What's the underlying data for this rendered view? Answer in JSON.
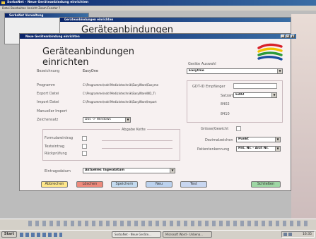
{
  "outer_window": {
    "title": "SorbaNet - Neue Geräteanbindung einrichten"
  },
  "menu": {
    "text": "Datei  Bearbeiten  Ansicht  Zoom  Fenster  ?"
  },
  "mdi_window": {
    "title": "SorbaNet Verwaltung"
  },
  "back_window": {
    "title": "Geräteanbindungen einrichten"
  },
  "back_heading": "Geräteanbindungen",
  "dialog": {
    "title": "Neue Geräteanbindung einrichten"
  },
  "form": {
    "heading_line1": "Geräteanbindungen",
    "heading_line2": "einrichten",
    "bezeichnung_label": "Bezeichnung",
    "bezeichnung_value": "EasyOne",
    "programm_label": "Programm",
    "programm_value": "C:\\Programme\\ndd Medizintechnik\\EasyWare\\Easyme",
    "export_label": "Export Datei",
    "export_value": "C:\\Programme\\ndd Medizintechnik\\EasyWare\\ND_T\\",
    "import_label": "Import Datei",
    "import_value": "C:\\Programme\\ndd Medizintechnik\\EasyWare\\Import",
    "manueller_label": "Manueller Import",
    "zeichensatz_label": "Zeichensatz",
    "zeichensatz_value": "Dos -> Windows",
    "abgabe_title": "Abgabe Kette",
    "formular_label": "Formulareintrag",
    "texteintrag_label": "Texteintrag",
    "rueckpruefung_label": "Rückprüfung",
    "eintragsdatum_label": "Eintragsdatum",
    "eintragsdatum_value": "Aktuelles Tagesdatum"
  },
  "right": {
    "geraet_label": "Geräte Auswahl",
    "geraet_value": "EasyOne",
    "gdt_label": "GDT-ID Empfänger",
    "gdt_value": "",
    "satzart_label": "Satzart",
    "satzart_value": "6302",
    "code_8402": "8402",
    "code_8410": "8410",
    "groesse_label": "Grösse/Gewicht",
    "dezimal_label": "Dezimalzeichen",
    "dezimal_value": "Punkt",
    "patient_label": "Patientenkennung",
    "patient_value": "Pat. Nr. - Arzt Nr."
  },
  "buttons": {
    "abbrechen": "Abbrechen",
    "loeschen": "Löschen",
    "speichern": "Speichern",
    "neu": "Neu",
    "test": "Test",
    "schliessen": "Schließen"
  },
  "taskbar": {
    "start": "Start",
    "task1": "SorbaNet - Neue Geräte...",
    "task2": "Microsoft Word - Unbena...",
    "clock": "16:35"
  },
  "colors": {
    "logo_red": "#d8222a",
    "logo_yellow": "#f2c200",
    "logo_green": "#2b9a3a",
    "logo_blue": "#1c4fa0",
    "btn_abbrechen": "#ffe78a",
    "btn_loeschen": "#ee8a7c",
    "btn_speichern": "#c4dbf0",
    "btn_neu": "#bcd2ee",
    "btn_test": "#c8d6f0",
    "btn_schliessen": "#9ed6a4"
  }
}
